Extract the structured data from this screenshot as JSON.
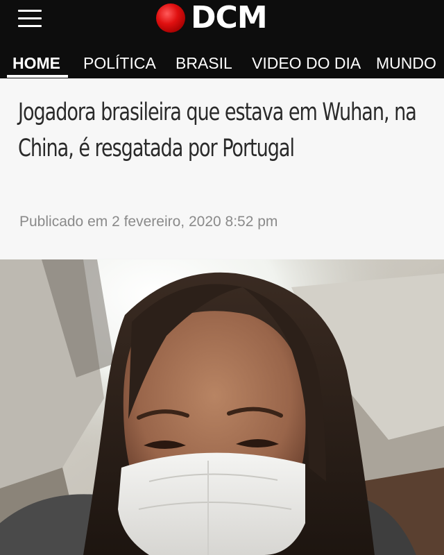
{
  "header": {
    "brand": "DCM",
    "menu_icon": "hamburger-icon",
    "logo_icon": "red-globe-icon",
    "colors": {
      "background": "#0d0d0d",
      "accent": "#e01010",
      "text": "#ffffff"
    }
  },
  "nav": {
    "items": [
      {
        "label": "HOME",
        "active": true
      },
      {
        "label": "POLÍTICA",
        "active": false
      },
      {
        "label": "BRASIL",
        "active": false
      },
      {
        "label": "VIDEO DO DIA",
        "active": false
      },
      {
        "label": "MUNDO",
        "active": false
      }
    ]
  },
  "article": {
    "title": "Jogadora brasileira que estava em Wuhan, na China, é resgatada por Portugal",
    "published": "Publicado em 2 fevereiro, 2020 8:52 pm",
    "image_subject": "selfie of young woman wearing white face mask on airplane"
  }
}
